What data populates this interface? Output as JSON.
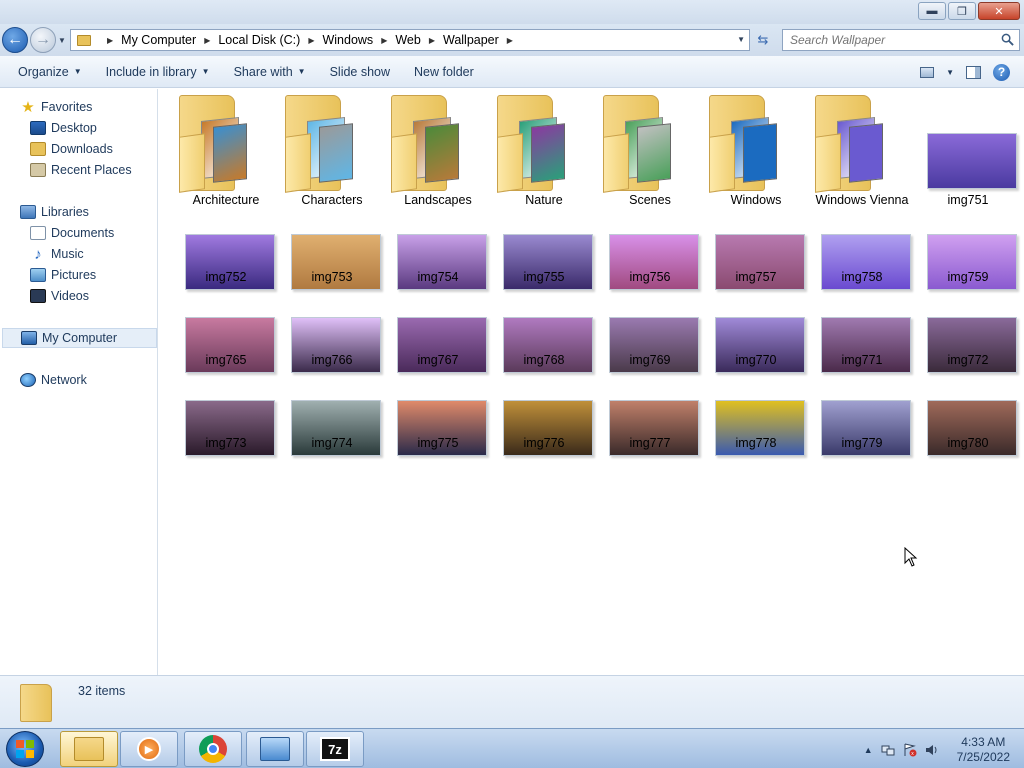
{
  "window": {
    "minimize_label": "▬",
    "maximize_label": "❐",
    "close_label": "✕"
  },
  "address": {
    "crumbs": [
      "My Computer",
      "Local Disk (C:)",
      "Windows",
      "Web",
      "Wallpaper"
    ],
    "search_placeholder": "Search Wallpaper"
  },
  "toolbar": {
    "organize": "Organize",
    "include_in_library": "Include in library",
    "share_with": "Share with",
    "slide_show": "Slide show",
    "new_folder": "New folder"
  },
  "nav": {
    "favorites": "Favorites",
    "desktop": "Desktop",
    "downloads": "Downloads",
    "recent_places": "Recent Places",
    "libraries": "Libraries",
    "documents": "Documents",
    "music": "Music",
    "pictures": "Pictures",
    "videos": "Videos",
    "my_computer": "My Computer",
    "network": "Network"
  },
  "items": [
    {
      "name": "Architecture",
      "kind": "folder",
      "colors": [
        "#c77a2a",
        "#3a8fd0"
      ]
    },
    {
      "name": "Characters",
      "kind": "folder",
      "colors": [
        "#5fb6e6",
        "#9a9a9a"
      ]
    },
    {
      "name": "Landscapes",
      "kind": "folder",
      "colors": [
        "#b87a3a",
        "#4d8a3a"
      ]
    },
    {
      "name": "Nature",
      "kind": "folder",
      "colors": [
        "#2aa07a",
        "#8a3aa0"
      ]
    },
    {
      "name": "Scenes",
      "kind": "folder",
      "colors": [
        "#4aa05a",
        "#c0c0c0"
      ]
    },
    {
      "name": "Windows",
      "kind": "folder",
      "colors": [
        "#1b6bc0",
        "#1b6bc0"
      ]
    },
    {
      "name": "Windows Vienna",
      "kind": "folder",
      "colors": [
        "#6a5ad0",
        "#6a5ad0"
      ]
    },
    {
      "name": "img751",
      "kind": "image",
      "colors": [
        "#8a6ad8",
        "#4a3aa0"
      ]
    },
    {
      "name": "img752",
      "kind": "image",
      "colors": [
        "#a07ae0",
        "#3a2a80"
      ]
    },
    {
      "name": "img753",
      "kind": "image",
      "colors": [
        "#e0b070",
        "#b07a40"
      ]
    },
    {
      "name": "img754",
      "kind": "image",
      "colors": [
        "#c8a0e8",
        "#5a3a80"
      ]
    },
    {
      "name": "img755",
      "kind": "image",
      "colors": [
        "#9a8ad0",
        "#3a2a6a"
      ]
    },
    {
      "name": "img756",
      "kind": "image",
      "colors": [
        "#d890e8",
        "#a04a80"
      ]
    },
    {
      "name": "img757",
      "kind": "image",
      "colors": [
        "#b87ab0",
        "#8a4a70"
      ]
    },
    {
      "name": "img758",
      "kind": "image",
      "colors": [
        "#b0a0f0",
        "#6a4ad0"
      ]
    },
    {
      "name": "img759",
      "kind": "image",
      "colors": [
        "#d0a0f0",
        "#8a5ad0"
      ]
    },
    {
      "name": "img765",
      "kind": "image",
      "colors": [
        "#c87aa0",
        "#6a3a5a"
      ]
    },
    {
      "name": "img766",
      "kind": "image",
      "colors": [
        "#e0c0f8",
        "#3a2a4a"
      ]
    },
    {
      "name": "img767",
      "kind": "image",
      "colors": [
        "#9a6ab0",
        "#4a2a5a"
      ]
    },
    {
      "name": "img768",
      "kind": "image",
      "colors": [
        "#b07ac0",
        "#5a3a5a"
      ]
    },
    {
      "name": "img769",
      "kind": "image",
      "colors": [
        "#9a7ab0",
        "#4a3a4a"
      ]
    },
    {
      "name": "img770",
      "kind": "image",
      "colors": [
        "#a08ad8",
        "#3a2a5a"
      ]
    },
    {
      "name": "img771",
      "kind": "image",
      "colors": [
        "#a07ab0",
        "#4a2a4a"
      ]
    },
    {
      "name": "img772",
      "kind": "image",
      "colors": [
        "#8a6a9a",
        "#3a2a3a"
      ]
    },
    {
      "name": "img773",
      "kind": "image",
      "colors": [
        "#8a6a8a",
        "#2a1a2a"
      ]
    },
    {
      "name": "img774",
      "kind": "image",
      "colors": [
        "#a0b0b0",
        "#2a3a3a"
      ]
    },
    {
      "name": "img775",
      "kind": "image",
      "colors": [
        "#e08a6a",
        "#2a2a4a"
      ]
    },
    {
      "name": "img776",
      "kind": "image",
      "colors": [
        "#c0903a",
        "#3a2a1a"
      ]
    },
    {
      "name": "img777",
      "kind": "image",
      "colors": [
        "#c0806a",
        "#3a2a2a"
      ]
    },
    {
      "name": "img778",
      "kind": "image",
      "colors": [
        "#e0c020",
        "#3a5ab0"
      ]
    },
    {
      "name": "img779",
      "kind": "image",
      "colors": [
        "#a0a0d0",
        "#3a3a6a"
      ]
    },
    {
      "name": "img780",
      "kind": "image",
      "colors": [
        "#a06a5a",
        "#3a2a2a"
      ]
    }
  ],
  "status": {
    "item_count": "32 items"
  },
  "taskbar": {
    "apps": [
      "windows-explorer",
      "media-player",
      "chrome",
      "control-panel",
      "7-zip"
    ],
    "seven_zip_label": "7z",
    "time": "4:33 AM",
    "date": "7/25/2022"
  },
  "colors": {
    "accent": "#1e395b",
    "selection": "#e5eef8",
    "folder_yellow": "#e8c25a"
  }
}
